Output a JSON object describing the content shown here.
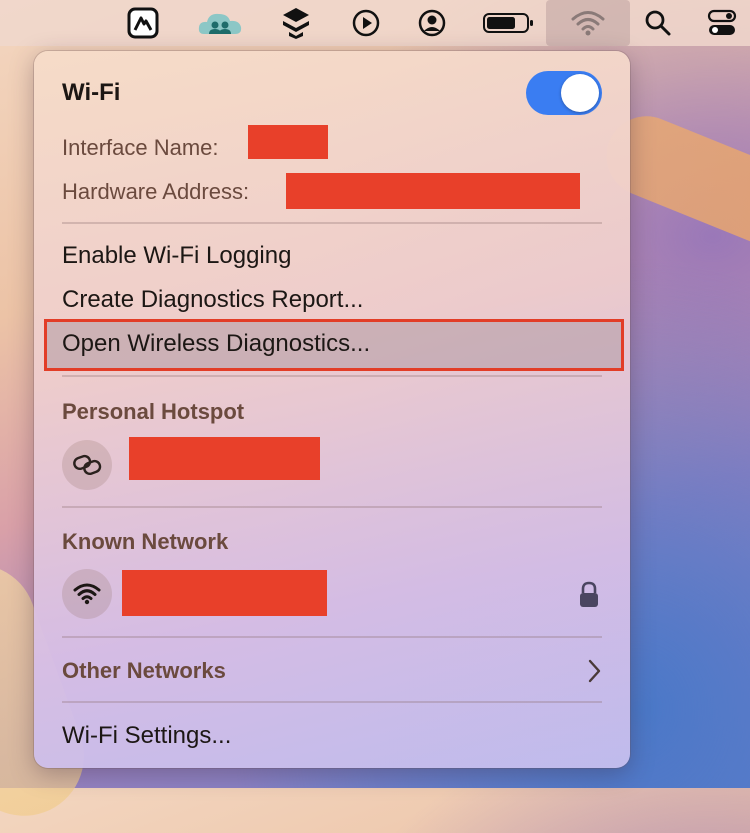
{
  "menubar": {
    "icons": [
      "nordvpn-icon",
      "cloud-people-icon",
      "stack-app-icon",
      "play-circle-icon",
      "user-circle-icon",
      "battery-icon",
      "wifi-icon",
      "search-icon",
      "control-center-icon"
    ]
  },
  "wifi": {
    "title": "Wi-Fi",
    "toggle_on": true,
    "interface_label": "Interface Name:",
    "hardware_label": "Hardware Address:"
  },
  "actions": {
    "enable_logging": "Enable Wi-Fi Logging",
    "diagnostics_report": "Create Diagnostics Report...",
    "wireless_diagnostics": "Open Wireless Diagnostics..."
  },
  "hotspot": {
    "header": "Personal Hotspot"
  },
  "known": {
    "header": "Known Network"
  },
  "other": {
    "label": "Other Networks"
  },
  "settings": {
    "label": "Wi-Fi Settings..."
  },
  "colors": {
    "accent": "#3a7df2",
    "highlight_border": "#e23d27",
    "redaction": "#e8402a"
  }
}
